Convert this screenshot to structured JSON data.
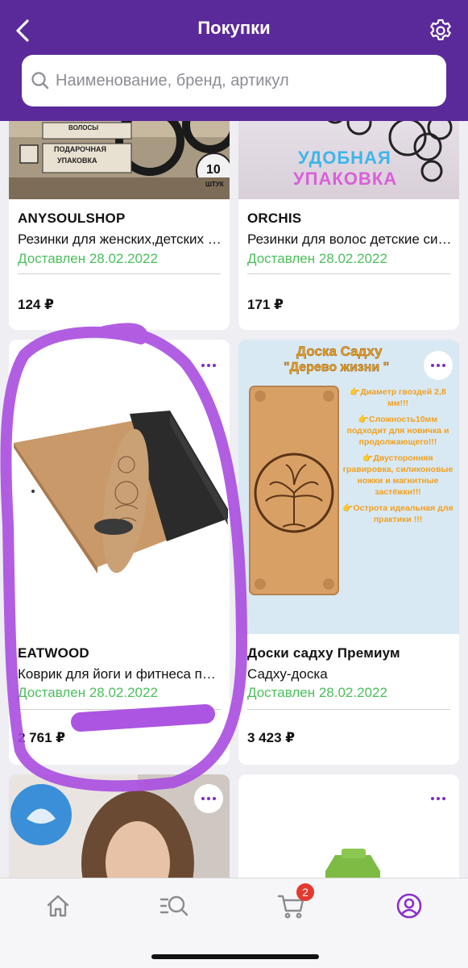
{
  "header": {
    "title": "Покупки",
    "search_placeholder": "Наименование, бренд, артикул"
  },
  "colors": {
    "header_bg": "#5a2a9a",
    "status_green": "#4bbf5a",
    "accent_purple": "#7a2ec0",
    "badge_red": "#e4392f"
  },
  "icons": {
    "back": "chevron-left-icon",
    "settings": "gear-icon",
    "search": "search-icon",
    "more": "more-horizontal-icon",
    "home": "home-icon",
    "catalog": "catalog-search-icon",
    "cart": "cart-icon",
    "profile": "profile-icon"
  },
  "products": [
    {
      "brand": "ANYSOULSHOP",
      "name": "Резинки для женских,детских волос",
      "status": "Доставлен 28.02.2022",
      "price": "124 ₽",
      "image_text": [
        "ВОЛОСЫ",
        "ПОДАРОЧНАЯ",
        "УПАКОВКА",
        "10",
        "ШТУК"
      ]
    },
    {
      "brand": "ORCHIS",
      "name": "Резинки для волос детские силиконовые",
      "status": "Доставлен 28.02.2022",
      "price": "171 ₽",
      "image_text": [
        "УДОБНАЯ",
        "УПАКОВКА"
      ]
    },
    {
      "brand": "EATWOOD",
      "name": "Коврик для йоги и фитнеса пробковый",
      "status": "Доставлен 28.02.2022",
      "price": "2 761 ₽"
    },
    {
      "brand": "Доски садху Премиум",
      "name": "Садху-доска",
      "status": "Доставлен 28.02.2022",
      "price": "3 423 ₽",
      "image_text": {
        "title": "Доска Садху",
        "subtitle": "\"Дерево жизни \"",
        "bullets": [
          "👉Диаметр гвоздей 2,8 мм!!!",
          "👉Сложность10мм подходит для новичка и продолжающего!!!",
          "👉Двусторонняя гравировка, силиконовые ножки и магнитные застёжки!!!",
          "👉Острота идеальная для практики !!!"
        ]
      }
    },
    {
      "brand": "",
      "name": "",
      "status": "",
      "price": ""
    },
    {
      "brand": "",
      "name": "",
      "status": "",
      "price": ""
    }
  ],
  "bottom_nav": {
    "cart_badge": "2",
    "active_tab": "profile"
  }
}
